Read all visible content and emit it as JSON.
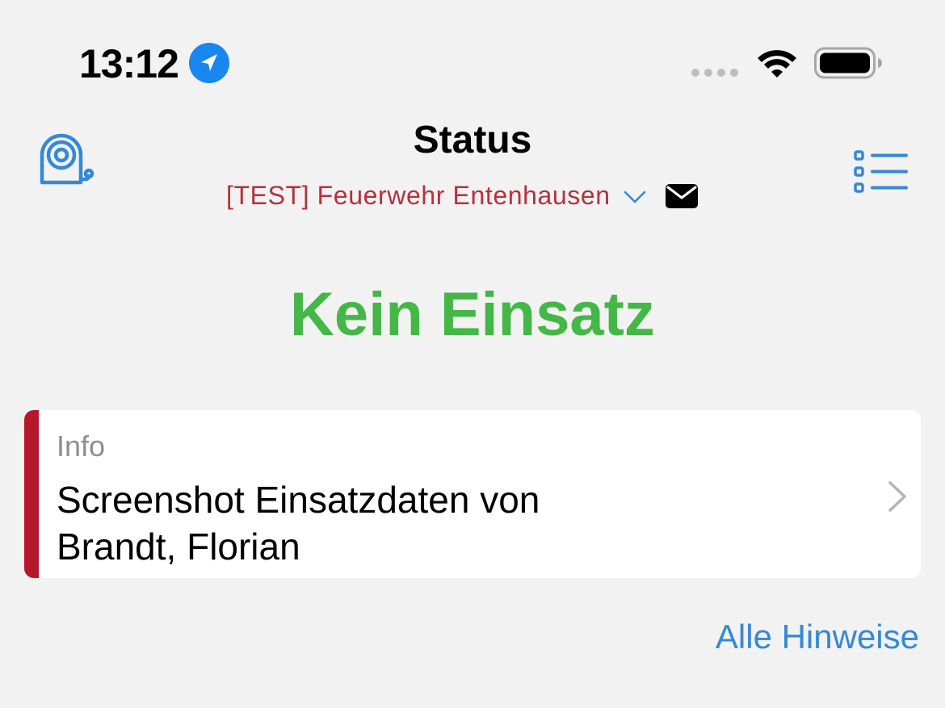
{
  "status_bar": {
    "time": "13:12",
    "location_icon": "location-arrow-icon",
    "cellular_icon": "signal-dots-icon",
    "wifi_icon": "wifi-icon",
    "battery_icon": "battery-icon"
  },
  "header": {
    "left_icon": "alarm-bell-icon",
    "title": "Status",
    "organization": "[TEST] Feuerwehr Entenhausen",
    "organization_dropdown_icon": "chevron-down-icon",
    "message_icon": "envelope-icon",
    "right_icon": "list-icon"
  },
  "main": {
    "status_text": "Kein Einsatz"
  },
  "info_card": {
    "category": "Info",
    "text_line_1": "Screenshot Einsatzdaten von",
    "text_line_2": "Brandt, Florian",
    "chevron_icon": "chevron-right-icon"
  },
  "footer": {
    "all_hints_link": "Alle Hinweise"
  },
  "colors": {
    "background": "#f2f2f2",
    "accent_blue": "#3488d8",
    "organization_red": "#b8303c",
    "status_green": "#43b846",
    "card_accent_red": "#b6172a",
    "muted_gray": "#8e8e93"
  }
}
